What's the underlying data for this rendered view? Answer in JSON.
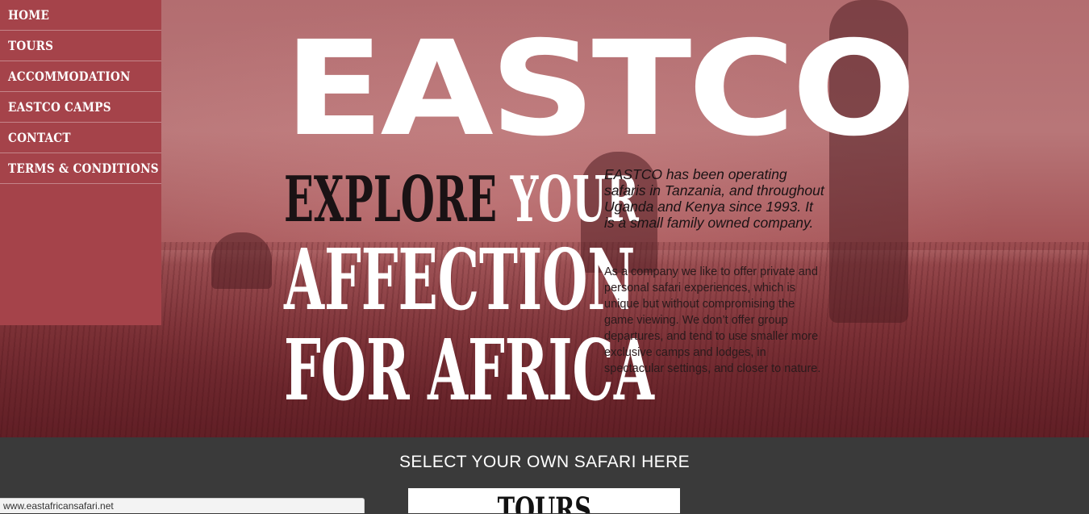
{
  "nav": {
    "items": [
      {
        "label": "HOME"
      },
      {
        "label": "TOURS"
      },
      {
        "label": "ACCOMMODATION"
      },
      {
        "label": "EASTCO CAMPS"
      },
      {
        "label": "CONTACT"
      },
      {
        "label": "TERMS & CONDITIONS"
      }
    ]
  },
  "hero": {
    "logo": "EASTCO",
    "tagline": {
      "line1_dark": "EXPLORE",
      "line1_light": "YOUR",
      "line2": "AFFECTION",
      "line3": "FOR AFRICA"
    },
    "intro": "EASTCO has been operating safaris in Tanzania, and throughout Uganda and Kenya since 1993. It is a small family owned company.",
    "body": "As a company we like to offer private and personal safari experiences, which is unique but without compromising the game viewing. We don’t offer group departures, and tend to use smaller more exclusive camps and lodges, in spectacular settings, and closer to nature."
  },
  "select": {
    "title": "SELECT YOUR OWN SAFARI HERE",
    "tours_label": "TOURS"
  },
  "status": {
    "url": "www.eastafricansafari.net"
  },
  "colors": {
    "nav_background": "#a5434a",
    "footer_background": "#3a3a3a",
    "hero_tint": "#a55558"
  }
}
